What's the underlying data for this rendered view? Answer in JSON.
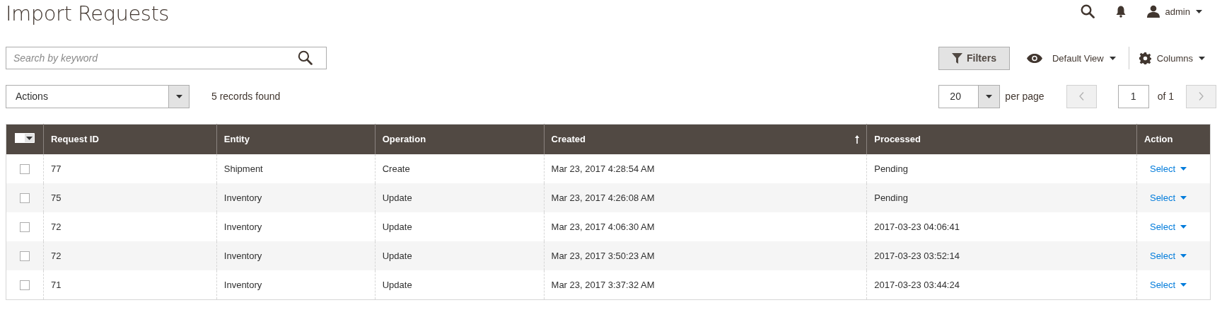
{
  "page_title": "Import Requests",
  "header_actions": {
    "user": "admin"
  },
  "search": {
    "placeholder": "Search by keyword"
  },
  "toolbar": {
    "filters": "Filters",
    "view": "Default View",
    "columns": "Columns"
  },
  "mass_actions": {
    "label": "Actions",
    "records": "5 records found"
  },
  "pager": {
    "per_page_value": "20",
    "per_page_label": "per page",
    "page": "1",
    "of": "of 1"
  },
  "table": {
    "select_all_checked": false,
    "columns": [
      {
        "label": "Request ID"
      },
      {
        "label": "Entity"
      },
      {
        "label": "Operation"
      },
      {
        "label": "Created",
        "sorted": true
      },
      {
        "label": "Processed"
      },
      {
        "label": "Action"
      }
    ],
    "rows": [
      {
        "checked": false,
        "cells": [
          "77",
          "Shipment",
          "Create",
          "Mar 23, 2017 4:28:54 AM",
          "Pending"
        ],
        "action": "Select"
      },
      {
        "checked": false,
        "cells": [
          "75",
          "Inventory",
          "Update",
          "Mar 23, 2017 4:26:08 AM",
          "Pending"
        ],
        "action": "Select"
      },
      {
        "checked": false,
        "cells": [
          "72",
          "Inventory",
          "Update",
          "Mar 23, 2017 4:06:30 AM",
          "2017-03-23 04:06:41"
        ],
        "action": "Select"
      },
      {
        "checked": false,
        "cells": [
          "72",
          "Inventory",
          "Update",
          "Mar 23, 2017 3:50:23 AM",
          "2017-03-23 03:52:14"
        ],
        "action": "Select"
      },
      {
        "checked": false,
        "cells": [
          "71",
          "Inventory",
          "Update",
          "Mar 23, 2017 3:37:32 AM",
          "2017-03-23 03:44:24"
        ],
        "action": "Select"
      }
    ]
  }
}
